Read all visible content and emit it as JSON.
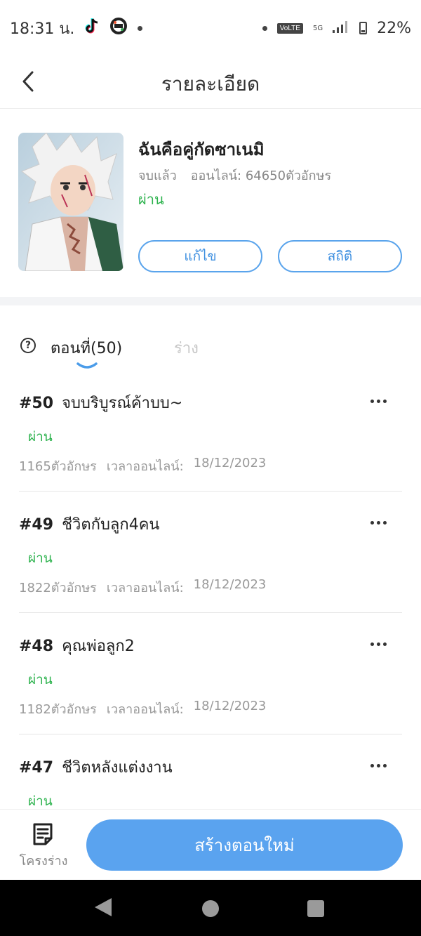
{
  "status_bar": {
    "time": "18:31 น.",
    "volte": "VoLTE",
    "network": "5G",
    "battery": "22%"
  },
  "header": {
    "title": "รายละเอียด"
  },
  "book": {
    "title": "ฉันคือคู่กัดซาเนมิ",
    "completion": "จบแล้ว",
    "online_chars": "ออนไลน์: 64650ตัวอักษร",
    "status": "ผ่าน",
    "edit_label": "แก้ไข",
    "stats_label": "สถิติ"
  },
  "tabs": {
    "help": "?",
    "chapters_label": "ตอนที่(50)",
    "drafts_label": "ร่าง"
  },
  "chapters": [
    {
      "num": "#50",
      "title": "จบบริบูรณ์ค้าบบ~",
      "status": "ผ่าน",
      "chars": "1165ตัวอักษร",
      "online_label": "เวลาออนไลน์:",
      "date": "18/12/2023"
    },
    {
      "num": "#49",
      "title": "ชีวิตกับลูก4คน",
      "status": "ผ่าน",
      "chars": "1822ตัวอักษร",
      "online_label": "เวลาออนไลน์:",
      "date": "18/12/2023"
    },
    {
      "num": "#48",
      "title": "คุณพ่อลูก2",
      "status": "ผ่าน",
      "chars": "1182ตัวอักษร",
      "online_label": "เวลาออนไลน์:",
      "date": "18/12/2023"
    },
    {
      "num": "#47",
      "title": "ชีวิตหลังแต่งงาน",
      "status": "ผ่าน",
      "chars": "",
      "online_label": "",
      "date": ""
    }
  ],
  "bottom_bar": {
    "draft_label": "โครงร่าง",
    "create_label": "สร้างตอนใหม่"
  },
  "colors": {
    "accent": "#5aa3ef",
    "status_green": "#2bb24c",
    "muted": "#999999"
  }
}
